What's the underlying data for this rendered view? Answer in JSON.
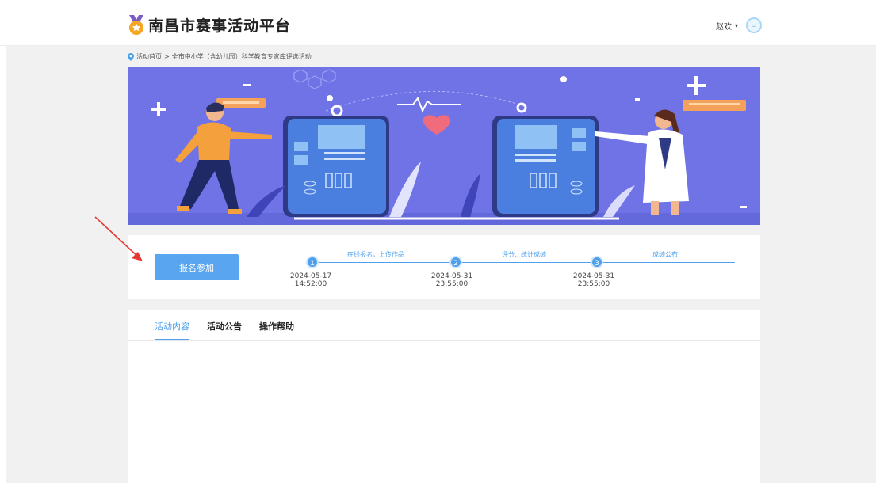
{
  "header": {
    "title": "南昌市赛事活动平台",
    "user_name": "赵欢",
    "user_caret": "▾"
  },
  "breadcrumb": {
    "home": "活动首页",
    "separator": ">",
    "current": "全市中小学（含幼儿园）科学教育专家库评选活动"
  },
  "steps": {
    "signup_label": "报名参加",
    "items": [
      {
        "number": "1",
        "label": "在线报名，上传作品",
        "date": "2024-05-17",
        "time": "14:52:00"
      },
      {
        "number": "2",
        "label": "评分、统计成绩",
        "date": "2024-05-31",
        "time": "23:55:00"
      },
      {
        "number": "3",
        "label": "成绩公布",
        "date": "2024-05-31",
        "time": "23:55:00"
      }
    ]
  },
  "tabs": [
    {
      "label": "活动内容",
      "active": true
    },
    {
      "label": "活动公告",
      "active": false
    },
    {
      "label": "操作帮助",
      "active": false
    }
  ],
  "colors": {
    "accent": "#4ea0ec",
    "button": "#5aa5ef",
    "banner_bg": "#6f73e6",
    "annotation_arrow": "#e53935"
  }
}
